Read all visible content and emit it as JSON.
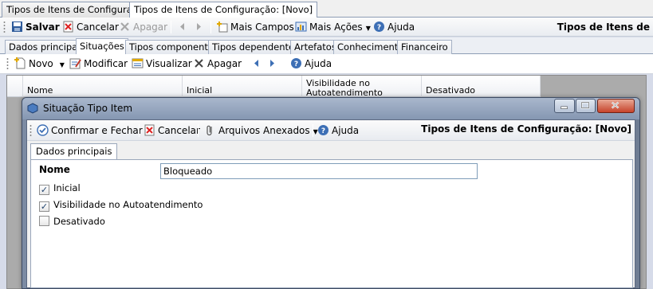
{
  "doc_tabs": [
    "Tipos de Itens de Configuração",
    "Tipos de Itens de Configuração: [Novo]"
  ],
  "main_toolbar": {
    "save": "Salvar",
    "cancel": "Cancelar",
    "delete": "Apagar",
    "more_fields": "Mais Campos",
    "more_actions": "Mais Ações",
    "help": "Ajuda",
    "right_title": "Tipos de Itens de"
  },
  "section_tabs": [
    "Dados principais",
    "Situações",
    "Tipos componentes",
    "Tipos dependentes",
    "Artefatos",
    "Conhecimento",
    "Financeiro"
  ],
  "sub_toolbar": {
    "new": "Novo",
    "modify": "Modificar",
    "view": "Visualizar",
    "delete": "Apagar",
    "help": "Ajuda"
  },
  "grid_columns": [
    "Nome",
    "Inicial",
    "Visibilidade no Autoatendimento",
    "Desativado"
  ],
  "dialog": {
    "title": "Situação Tipo Item",
    "toolbar": {
      "confirm": "Confirmar e Fechar",
      "cancel": "Cancelar",
      "attachments": "Arquivos Anexados",
      "help": "Ajuda",
      "right_title": "Tipos de Itens de Configuração: [Novo]"
    },
    "tab": "Dados principais",
    "nome_label": "Nome",
    "nome_value": "Bloqueado",
    "checkboxes": [
      {
        "label": "Inicial",
        "checked": true
      },
      {
        "label": "Visibilidade no Autoatendimento",
        "checked": true
      },
      {
        "label": "Desativado",
        "checked": false
      }
    ]
  },
  "colors": {
    "accent": "#3d6fb5",
    "dialog_frame": "#8597b2",
    "grid_bg": "#ababab"
  }
}
